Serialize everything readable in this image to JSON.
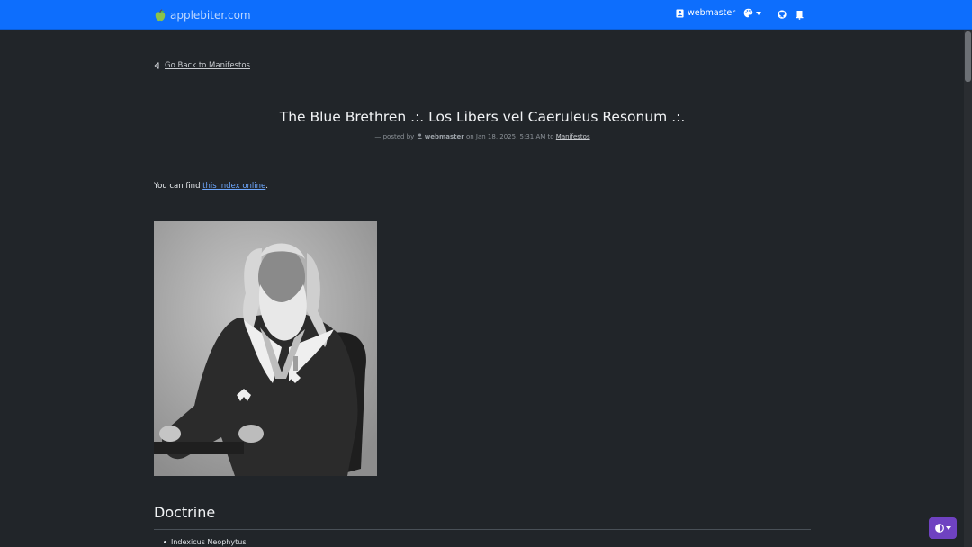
{
  "navbar": {
    "brand": "applebiter.com",
    "user": "webmaster"
  },
  "back_link": "Go Back to Manifestos",
  "post": {
    "title": "The Blue Brethren .:. Los Libers vel Caeruleus Resonum .:.",
    "meta_prefix": "— posted by",
    "author": "webmaster",
    "date_text": "on Jan 18, 2025, 5:31 AM to",
    "category": "Manifestos",
    "intro_before": "You can find ",
    "intro_link": "this index online",
    "intro_after": "."
  },
  "sections": [
    {
      "heading": "Doctrine",
      "items": [
        "Indexicus Neophytus"
      ]
    }
  ],
  "colors": {
    "navbar": "#0d6efd",
    "background": "#212529",
    "link": "#6ea8fe",
    "theme_button": "#6f42c1"
  },
  "icons": {
    "brand": "apple-icon",
    "user": "person-badge-icon",
    "theme": "palette-icon",
    "github": "github-icon",
    "notifications": "bell-icon",
    "back": "chevron-left-icon",
    "toggle": "contrast-icon"
  }
}
